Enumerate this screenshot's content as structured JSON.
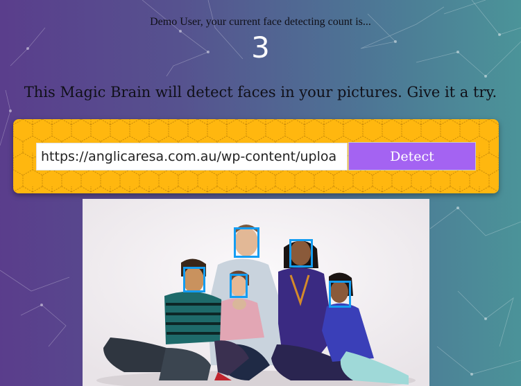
{
  "rank": {
    "message": "Demo User, your current face detecting count is...",
    "count": "3"
  },
  "tagline": "This Magic Brain will detect faces in your pictures. Give it a try.",
  "form": {
    "url_value": "https://anglicaresa.com.au/wp-content/uploa",
    "detect_label": "Detect"
  },
  "colors": {
    "gradient_start": "#5a3d8c",
    "gradient_end": "#4b9499",
    "panel": "#ffb70f",
    "button": "#a463f2",
    "face_box": "#149df2"
  },
  "image": {
    "description_icon": "family-photo"
  }
}
